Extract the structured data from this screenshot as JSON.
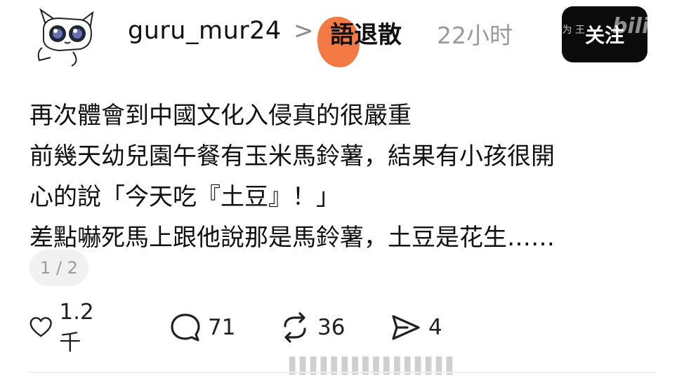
{
  "post": {
    "username": "guru_mur24",
    "chevron": ">",
    "topic": "語退散",
    "time": "22小时",
    "follow_label": "关注",
    "content_lines": [
      "再次體會到中國文化入侵真的很嚴重",
      "前幾天幼兒園午餐有玉米馬鈴薯，結果有小孩很開",
      "心的說「今天吃『土豆』！」",
      "差點嚇死馬上跟他說那是馬鈴薯，土豆是花生……"
    ],
    "page_indicator": "1 / 2"
  },
  "actions": {
    "like": {
      "icon": "heart-icon",
      "count": "1.2千"
    },
    "comment": {
      "icon": "comment-icon",
      "count": "71"
    },
    "repost": {
      "icon": "repost-icon",
      "count": "36"
    },
    "share": {
      "icon": "send-icon",
      "count": "4"
    }
  },
  "watermark": {
    "top_text": "由 帮为 王",
    "bili_text": "bilibili",
    "bottom_text": "▌▌▌▌▌▌▌▌▌▌▌▌▌▌▌▌"
  },
  "colors": {
    "text": "#111111",
    "muted": "#9a9a9a",
    "button_bg": "#0b0b0b",
    "redaction": "#f47a45",
    "pill_bg": "#f1f1f1"
  }
}
